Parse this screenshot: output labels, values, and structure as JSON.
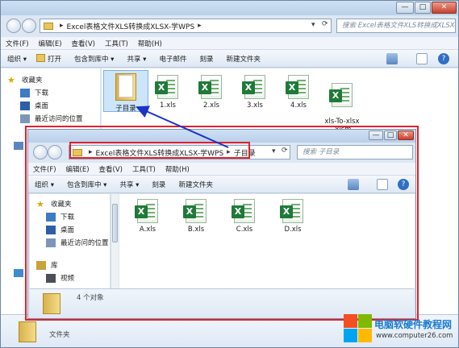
{
  "outer": {
    "breadcrumb": [
      "Excel表格文件XLS转换成XLSX-学WPS"
    ],
    "search_placeholder": "搜索 Excel表格文件XLS转换成XLSX-学WPS",
    "menu": [
      "文件(F)",
      "编辑(E)",
      "查看(V)",
      "工具(T)",
      "帮助(H)"
    ],
    "toolbar": [
      "组织 ▾",
      "打开",
      "包含到库中 ▾",
      "共享 ▾",
      "电子邮件",
      "刻录",
      "新建文件夹"
    ],
    "nav": [
      "收藏夹",
      "下载",
      "桌面",
      "最近访问的位置"
    ],
    "files": [
      {
        "name": "子目录",
        "type": "folder"
      },
      {
        "name": "1.xls",
        "type": "xls"
      },
      {
        "name": "2.xls",
        "type": "xls"
      },
      {
        "name": "3.xls",
        "type": "xls"
      },
      {
        "name": "4.xls",
        "type": "xls"
      },
      {
        "name": "xls-To-xlsx\n.xlsm",
        "type": "xlsm"
      }
    ],
    "status_type": "文件夹"
  },
  "inner": {
    "breadcrumb": [
      "Excel表格文件XLS转换成XLSX-学WPS",
      "子目录"
    ],
    "search_placeholder": "搜索 子目录",
    "menu": [
      "文件(F)",
      "编辑(E)",
      "查看(V)",
      "工具(T)",
      "帮助(H)"
    ],
    "toolbar": [
      "组织 ▾",
      "包含到库中 ▾",
      "共享 ▾",
      "刻录",
      "新建文件夹"
    ],
    "nav": [
      "收藏夹",
      "下载",
      "桌面",
      "最近访问的位置",
      "库",
      "视频"
    ],
    "files": [
      "A.xls",
      "B.xls",
      "C.xls",
      "D.xls"
    ],
    "status_count": "4 个对象"
  },
  "watermark": {
    "line1": "电脑软硬件教程网",
    "line2": "www.computer26.com"
  },
  "colors": {
    "highlight": "#e2202b",
    "arrow": "#1a35c8",
    "excel_green": "#1f7a39"
  }
}
